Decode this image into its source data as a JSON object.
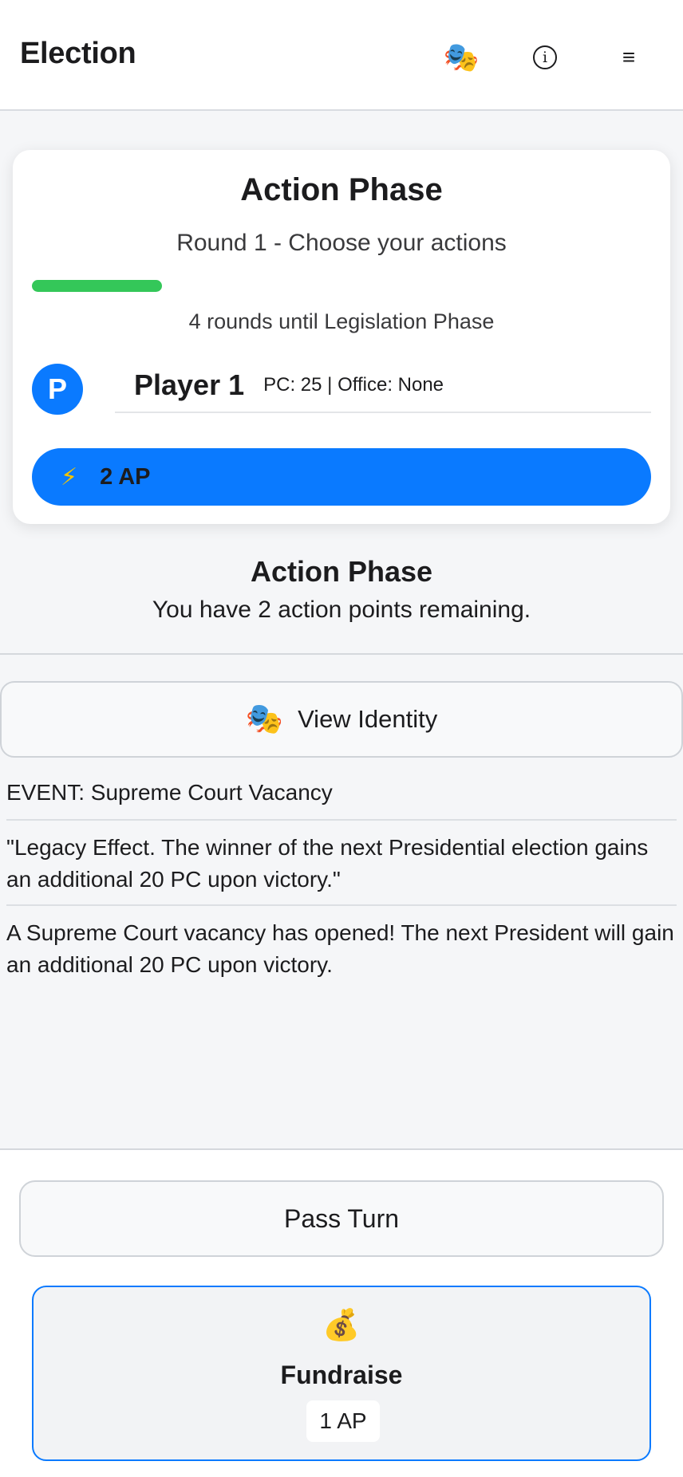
{
  "header": {
    "title": "Election",
    "theater_icon": "🎭",
    "info_icon": "i",
    "menu_icon": "≡"
  },
  "phase_card": {
    "title": "Action Phase",
    "subtitle": "Round 1 - Choose your actions",
    "progress_fraction": 0.21,
    "progress_color": "#34c759",
    "rounds_text": "4 rounds until Legislation Phase",
    "player": {
      "avatar_letter": "P",
      "name": "Player 1",
      "stats": "PC: 25 | Office: None"
    },
    "ap_icon": "⚡",
    "ap_label": "2 AP"
  },
  "action_section": {
    "title": "Action Phase",
    "subtitle": "You have 2 action points remaining."
  },
  "identity_button": {
    "icon": "🎭",
    "label": "View Identity"
  },
  "event": {
    "title": "EVENT: Supreme Court Vacancy",
    "quote": "\"Legacy Effect. The winner of the next Presidential election gains an additional 20 PC upon victory.\"",
    "description": "A Supreme Court vacancy has opened! The next President will gain an additional 20 PC upon victory."
  },
  "bottom": {
    "pass_label": "Pass Turn",
    "action": {
      "icon": "💰",
      "name": "Fundraise",
      "cost": "1 AP"
    }
  },
  "colors": {
    "accent": "#0a7aff",
    "progress": "#34c759"
  }
}
